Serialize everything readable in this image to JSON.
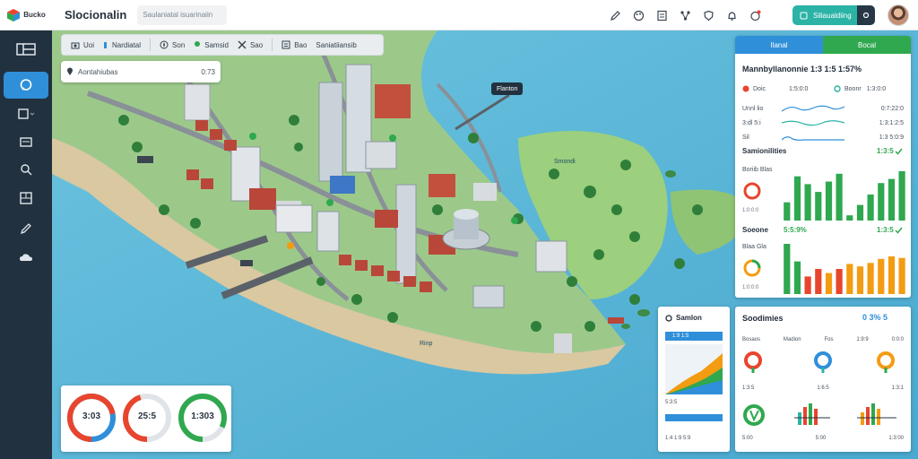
{
  "header": {
    "logo_text": "Bucko",
    "app_title": "Slocionalin",
    "search_placeholder": "Saulaniatal isuarinaiin",
    "action_button": "Siliaualdiing",
    "icons": [
      "edit-icon",
      "palette-icon",
      "document-icon",
      "network-icon",
      "shield-icon",
      "bell-icon",
      "alert-icon"
    ],
    "colors": {
      "accent": "#2bb3a6",
      "sidebar": "#22313f",
      "active": "#2f8fd9"
    }
  },
  "sidebar": {
    "items": [
      {
        "icon": "layout-icon"
      },
      {
        "icon": "chat-icon",
        "active": true
      },
      {
        "icon": "layers-icon"
      },
      {
        "icon": "monitor-icon"
      },
      {
        "icon": "search-icon"
      },
      {
        "icon": "grid-icon"
      },
      {
        "icon": "pen-icon"
      },
      {
        "icon": "cloud-icon"
      }
    ]
  },
  "map_toolbar": {
    "items": [
      {
        "label": "Uoi",
        "icon": "camera-icon"
      },
      {
        "label": "Nardiatal",
        "icon": "chart-icon"
      },
      {
        "label": "Son",
        "icon": "compass-icon"
      },
      {
        "label": "Samsid",
        "icon": "pin-icon"
      },
      {
        "label": "Sao",
        "icon": "tools-icon"
      },
      {
        "label": "Bao",
        "icon": "list-icon"
      },
      {
        "label": "Saniatiiansib",
        "icon": ""
      }
    ]
  },
  "map": {
    "search_label": "Aontahiubas",
    "search_value": "0:73",
    "badge": "Flanton",
    "label_bay": "Smondi",
    "label_pier": "Rinp"
  },
  "right_panel": {
    "tab_left": "Ilanal",
    "tab_right": "Bocal",
    "title": "Mannbyllanonnie 1:3 1:5 1:57%",
    "row1": {
      "left": "Doic",
      "mid": "1:5:0:0",
      "right_label": "Boonr",
      "right_val": "1:3:0:0"
    },
    "row2": {
      "label": "Unnl lio",
      "val": "0:7:22:0"
    },
    "row3": {
      "label": "3:dl 5:i",
      "val": "1:3:1:2:5"
    },
    "row4": {
      "label": "Sil",
      "val": "1:3 5:0:9"
    },
    "section1": {
      "title": "Samionilities",
      "value": "1:3:5"
    },
    "chart1": {
      "label": "Boriib Blas",
      "sub": "1:0:0:0"
    },
    "section2": {
      "title": "Soeone",
      "value": "5:5:9%",
      "value2": "1:3:5"
    },
    "chart2": {
      "label": "Blaa Gla",
      "sub": "1:0:0:0"
    }
  },
  "stats_card": {
    "title": "Soodimies",
    "value": "0 3% 5",
    "columns": [
      "Bosaos",
      "Madion",
      "Fos",
      "1:9:9",
      "0:0:0"
    ],
    "row_a": [
      "1:3:5",
      "1:6:5",
      "1:3:1"
    ],
    "row_b": [
      "5:00",
      "5:00",
      "1:3:00"
    ]
  },
  "center_card": {
    "title": "Samlon",
    "line1": "1:9 1:5",
    "line2": "5:3:5",
    "line3": "1:4 1:9 5:9"
  },
  "gauges": [
    {
      "value": "3:03",
      "fraction": 0.72,
      "color": "#e8452e",
      "color2": "#2f8fd9"
    },
    {
      "value": "25:5",
      "fraction": 0.45,
      "color": "#e8452e",
      "color2": "#e0e4e8"
    },
    {
      "value": "1:303",
      "fraction": 0.82,
      "color": "#2fa84f",
      "color2": "#e0e4e8"
    }
  ],
  "chart_data": [
    {
      "type": "bar",
      "series": [
        {
          "values": [
            0.35,
            0.85,
            0.7,
            0.55,
            0.75,
            0.9,
            0.1,
            0.3,
            0.5,
            0.72,
            0.8,
            0.95
          ],
          "colors": [
            "#2fa84f",
            "#2fa84f",
            "#2fa84f",
            "#2fa84f",
            "#2fa84f",
            "#2fa84f",
            "#2fa84f",
            "#2fa84f",
            "#2fa84f",
            "#2fa84f",
            "#2fa84f",
            "#2fa84f"
          ]
        }
      ],
      "ylim": [
        0,
        1
      ]
    },
    {
      "type": "bar",
      "series": [
        {
          "values": [
            1.0,
            0.65,
            0.35,
            0.5,
            0.42,
            0.5,
            0.6,
            0.55,
            0.62,
            0.7,
            0.75,
            0.72
          ],
          "colors": [
            "#2fa84f",
            "#2fa84f",
            "#e8452e",
            "#e8452e",
            "#f39c12",
            "#e8452e",
            "#f39c12",
            "#f39c12",
            "#f39c12",
            "#f39c12",
            "#f39c12",
            "#f39c12"
          ]
        }
      ],
      "ylim": [
        0,
        1
      ]
    }
  ]
}
